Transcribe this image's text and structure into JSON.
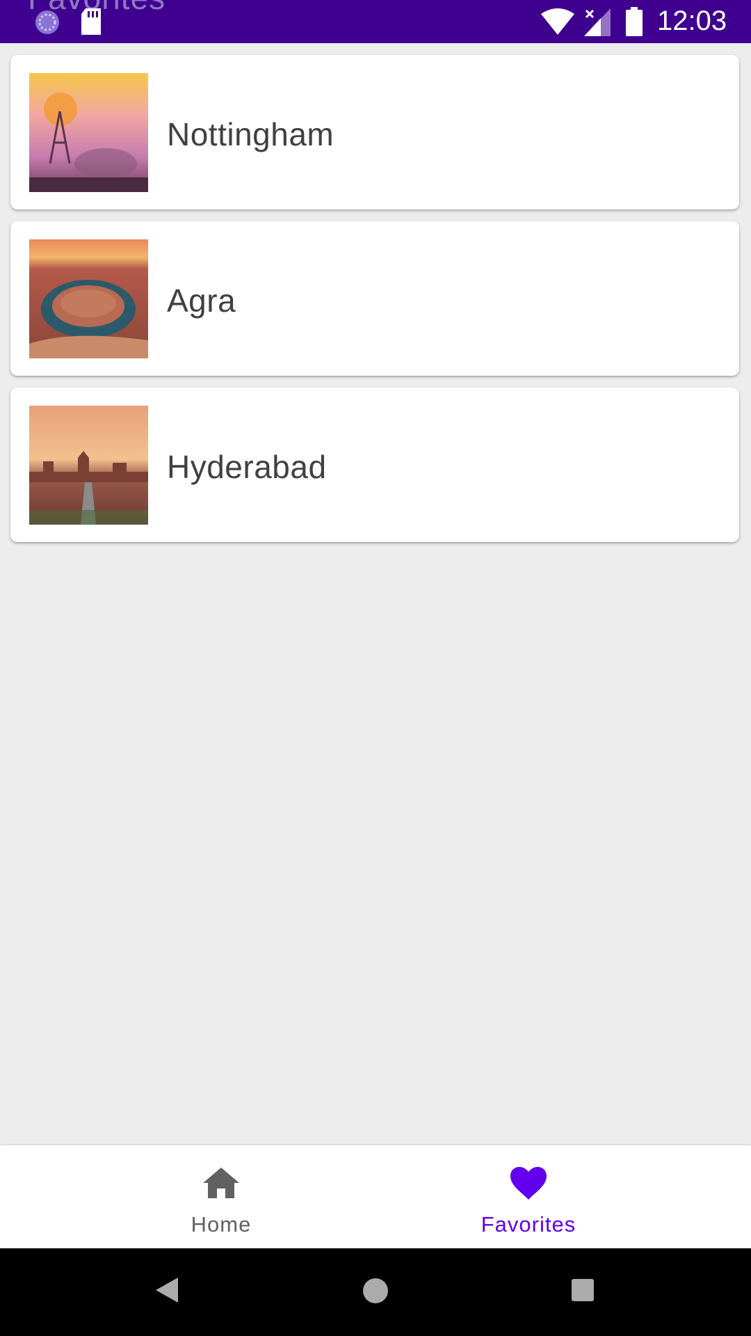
{
  "status_bar": {
    "background": "#3f0090",
    "ghost_title": "Favorites",
    "time": "12:03",
    "icons": [
      "sync-icon",
      "sd-card-icon",
      "wifi-icon",
      "signal-icon",
      "battery-icon"
    ]
  },
  "favorites": [
    {
      "title": "Nottingham",
      "image": "windmill-sunset-photo"
    },
    {
      "title": "Agra",
      "image": "canyon-river-bend-photo"
    },
    {
      "title": "Hyderabad",
      "image": "desert-road-mesas-photo"
    }
  ],
  "bottom_nav": {
    "items": [
      {
        "label": "Home",
        "icon": "home-icon",
        "color": "#616161",
        "selected": false
      },
      {
        "label": "Favorites",
        "icon": "heart-icon",
        "color": "#6200ee",
        "selected": true
      }
    ]
  },
  "system_nav": {
    "buttons": [
      "back-icon",
      "home-circle-icon",
      "recents-icon"
    ]
  }
}
